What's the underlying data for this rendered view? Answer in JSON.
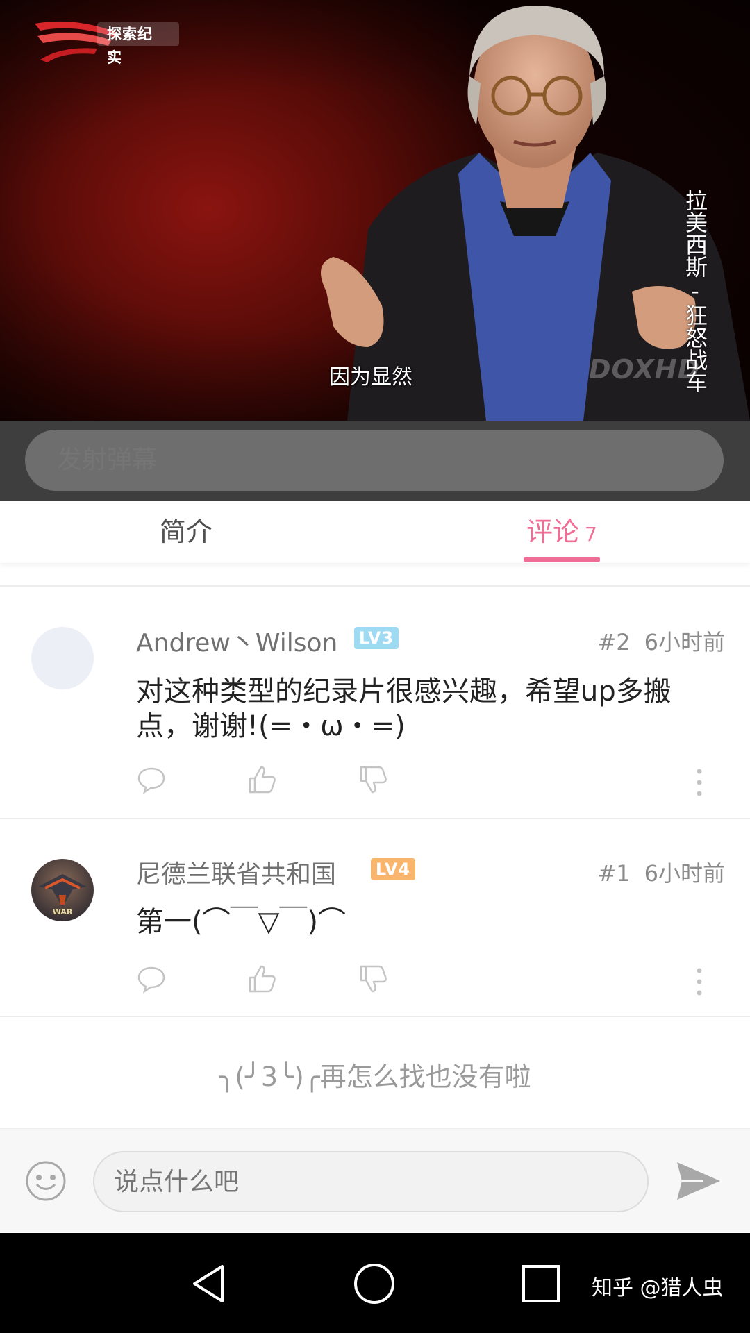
{
  "video": {
    "channel_name": "探索纪实",
    "subtitle": "因为显然",
    "side_title": "拉美西斯-狂怒战车",
    "watermark": "DOXHD",
    "brand_colors": {
      "logo_red": "#d8262b",
      "background_red": "#8a1410"
    }
  },
  "danmaku": {
    "placeholder": "发射弹幕"
  },
  "tabs": {
    "intro_label": "简介",
    "comments_label": "评论",
    "comments_count": "7",
    "active_color": "#f06d95"
  },
  "comments": [
    {
      "username": "Andrew丶Wilson",
      "level": "LV3",
      "floor": "#2",
      "time": "6小时前",
      "content": "对这种类型的纪录片很感兴趣，希望up多搬点，谢谢!(=・ω・=)",
      "avatar": "blank-avatar"
    },
    {
      "username": "尼德兰联省共和国",
      "level": "LV4",
      "floor": "#1",
      "time": "6小时前",
      "content": "第一(⌒￣▽￣)⌒",
      "avatar": "war-game-avatar"
    }
  ],
  "icons": [
    "reply-icon",
    "like-icon",
    "dislike-icon",
    "more-icon",
    "emoji-icon",
    "send-icon",
    "back-icon",
    "home-icon",
    "recents-icon"
  ],
  "end_message": "╮(╯3╰)╭再怎么找也没有啦",
  "reply_bar": {
    "placeholder": "说点什么吧"
  },
  "attribution": "知乎 @猎人虫"
}
